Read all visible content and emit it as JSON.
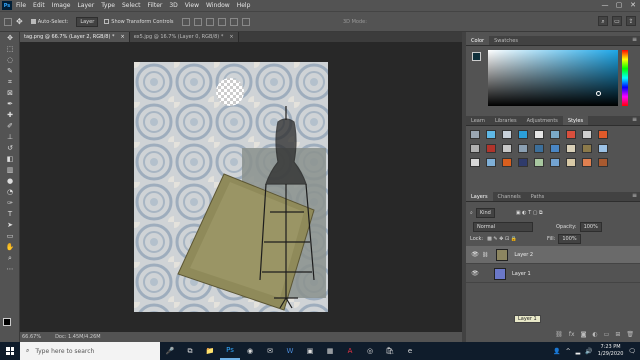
{
  "menubar": {
    "logo": "Ps",
    "items": [
      "File",
      "Edit",
      "Image",
      "Layer",
      "Type",
      "Select",
      "Filter",
      "3D",
      "View",
      "Window",
      "Help"
    ],
    "minimize": "—",
    "maximize": "▢",
    "close": "✕"
  },
  "options": {
    "auto_select_label": "Auto-Select:",
    "auto_select_value": "Layer",
    "transform_label": "Show Transform Controls",
    "mode_label": "3D Mode:"
  },
  "tabs": [
    {
      "label": "tag.png @ 66.7% (Layer 2, RGB/8) *",
      "close": "×"
    },
    {
      "label": "ex5.jpg @ 16.7% (Layer 0, RGB/8) *",
      "close": "×"
    }
  ],
  "status": {
    "zoom": "66.67%",
    "doc": "Doc: 1.45M/4.26M"
  },
  "color_panel": {
    "tabs": [
      "Color",
      "Swatches"
    ],
    "fg_color": "#0f2f3a",
    "bg_color": "#ffffff"
  },
  "styles_panel": {
    "tabs": [
      "Learn",
      "Libraries",
      "Adjustments",
      "Styles"
    ],
    "swatch_colors": [
      "#9aa6b2",
      "#5fb8e6",
      "#c9d2db",
      "#2b9fd9",
      "#e6e6e6",
      "#7aa9c8",
      "#d94f3d",
      "#cfcfcf",
      "#e05a2a",
      "#b0b0b0",
      "#b0342b",
      "#c8c8c8",
      "#8ba0b3",
      "#3c6f9b",
      "#4a86c5",
      "#d9d0b8",
      "#8c7a4a",
      "#9cc2e6",
      "#d8d8d8",
      "#7fb0d8",
      "#d95f1e",
      "#2f3b6b",
      "#a8c7a0",
      "#73a3d1",
      "#d8c9a6",
      "#e08050",
      "#a85a30"
    ]
  },
  "layers_panel": {
    "tabs": [
      "Layers",
      "Channels",
      "Paths"
    ],
    "kind_label": "Kind",
    "blend_mode": "Normal",
    "opacity_label": "Opacity:",
    "opacity_value": "100%",
    "lock_label": "Lock:",
    "fill_label": "Fill:",
    "fill_value": "100%",
    "layers": [
      {
        "name": "Layer 2",
        "selected": true
      },
      {
        "name": "Layer 1",
        "selected": false
      }
    ],
    "tooltip": "Layer 1"
  },
  "taskbar": {
    "search_placeholder": "Type here to search",
    "time": "7:23 PM",
    "date": "1/29/2020"
  }
}
